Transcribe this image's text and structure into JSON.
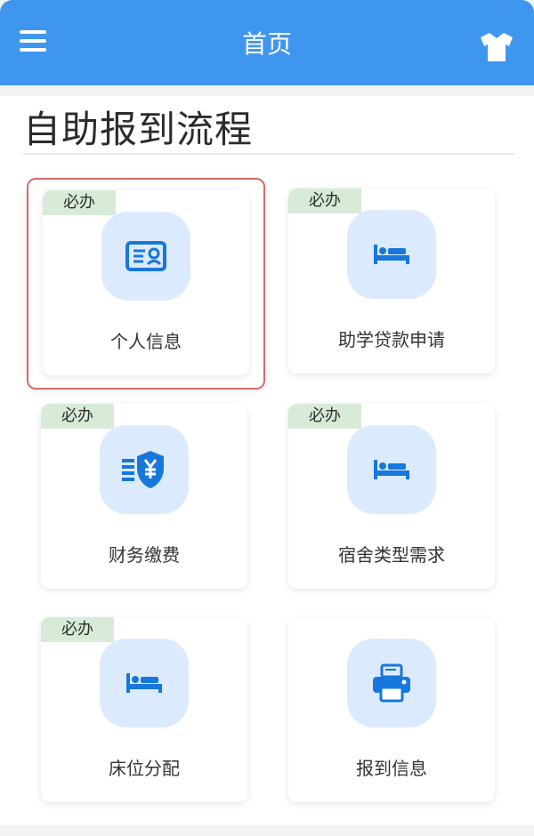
{
  "header": {
    "title": "首页",
    "menu_icon": "hamburger-menu-icon",
    "right_icon": "shirt-icon"
  },
  "section": {
    "title": "自助报到流程"
  },
  "cards": [
    {
      "label": "个人信息",
      "badge": "必办",
      "icon": "id-card-icon",
      "selected": true
    },
    {
      "label": "助学贷款申请",
      "badge": "必办",
      "icon": "bed-icon",
      "selected": false
    },
    {
      "label": "财务缴费",
      "badge": "必办",
      "icon": "yuan-shield-icon",
      "selected": false
    },
    {
      "label": "宿舍类型需求",
      "badge": "必办",
      "icon": "bed-icon",
      "selected": false
    },
    {
      "label": "床位分配",
      "badge": "必办",
      "icon": "bed-icon",
      "selected": false
    },
    {
      "label": "报到信息",
      "badge": "",
      "icon": "printer-icon",
      "selected": false
    }
  ],
  "colors": {
    "header_blue": "#3f96ee",
    "icon_blue": "#1877db",
    "badge_green": "#d7ebd8",
    "selection_red": "#d56b6b"
  }
}
